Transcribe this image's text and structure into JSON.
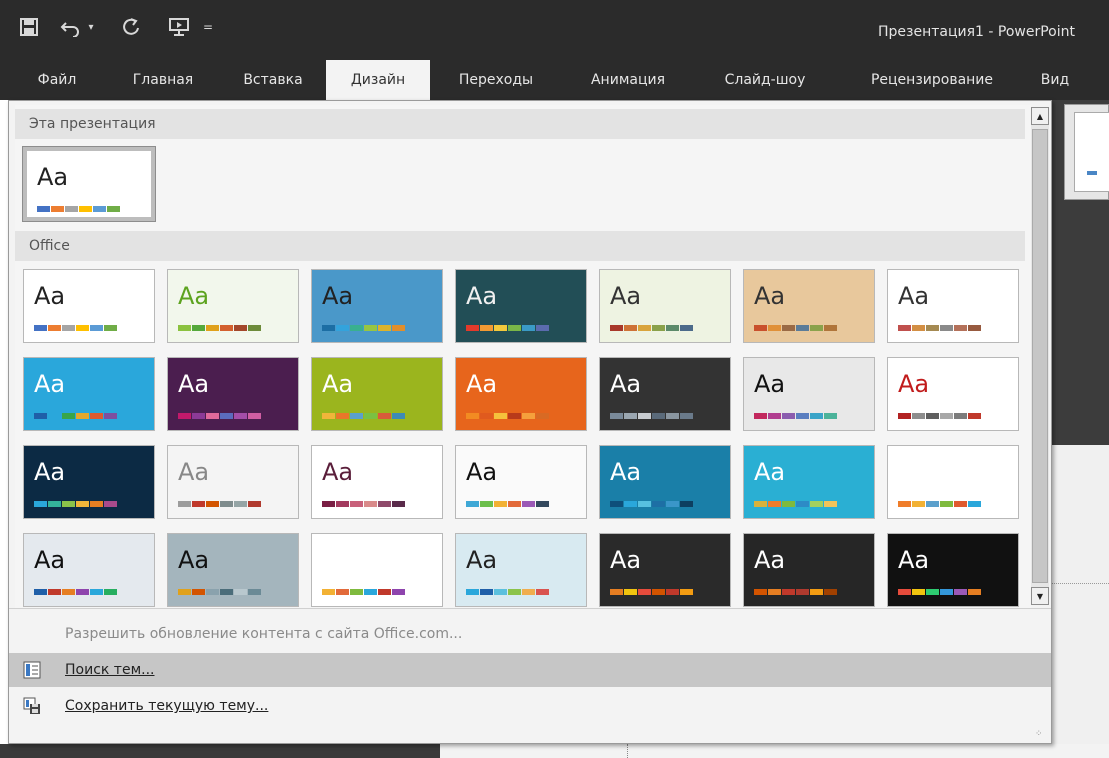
{
  "app": {
    "title": "Презентация1 - PowerPoint",
    "quick_access": [
      "save-icon",
      "undo-icon",
      "redo-icon",
      "start-from-beginning-icon",
      "customize-icon"
    ]
  },
  "tabs": [
    {
      "label": "Файл"
    },
    {
      "label": "Главная"
    },
    {
      "label": "Вставка"
    },
    {
      "label": "Дизайн",
      "active": true
    },
    {
      "label": "Переходы"
    },
    {
      "label": "Анимация"
    },
    {
      "label": "Слайд-шоу"
    },
    {
      "label": "Рецензирование"
    },
    {
      "label": "Вид"
    }
  ],
  "popup": {
    "section_this": "Эта презентация",
    "section_office": "Office",
    "sample_text": "Aa",
    "commands": {
      "enable_updates": "Разрешить обновление контента с сайта Office.com...",
      "browse_themes": "Поиск тем...",
      "save_theme": "Сохранить текущую тему..."
    }
  },
  "themes": [
    {
      "bg": "#ffffff",
      "text": "#222222",
      "bars": [
        "#4472c4",
        "#ed7d31",
        "#a5a5a5",
        "#ffc000",
        "#5b9bd5",
        "#70ad47"
      ]
    },
    {
      "bg": "#ffffff",
      "text": "#222222",
      "bars": [
        "#4472c4",
        "#ed7d31",
        "#a5a5a5",
        "#ffc000",
        "#5b9bd5",
        "#70ad47"
      ]
    },
    {
      "bg": "#f2f7ec",
      "text": "#5da31f",
      "bars": [
        "#8bc23f",
        "#55a93b",
        "#e0a11b",
        "#d3602e",
        "#a3472a",
        "#6d8b3a"
      ]
    },
    {
      "bg": "#4a98c9",
      "text": "#222222",
      "bars": [
        "#1c6ea4",
        "#33a3dc",
        "#39b08f",
        "#98c541",
        "#ddb32a",
        "#e08e2c"
      ]
    },
    {
      "bg": "#224e56",
      "text": "#f0f0f0",
      "bars": [
        "#e33a2b",
        "#f29a33",
        "#f3c93c",
        "#7ab648",
        "#3a9ac6",
        "#5b6bae"
      ]
    },
    {
      "bg": "#eef3e2",
      "text": "#333333",
      "bars": [
        "#a8382a",
        "#ce7236",
        "#d9a43c",
        "#8aa14a",
        "#5c8a6a",
        "#4c6a8a"
      ]
    },
    {
      "bg": "#e8c89c",
      "text": "#333333",
      "bars": [
        "#c9502c",
        "#e09038",
        "#9a6a45",
        "#5b7c99",
        "#8aa24b",
        "#b0753a"
      ]
    },
    {
      "bg": "#ffffff",
      "text": "#333333",
      "bars": [
        "#c0504d",
        "#d38f44",
        "#a58a52",
        "#8a8a8a",
        "#b4715a",
        "#975a3f"
      ]
    },
    {
      "bg": "#2aa7db",
      "text": "#ffffff",
      "bars": [
        "#1f5fa8",
        "#2aa7db",
        "#38a548",
        "#e4a82d",
        "#dd5a30",
        "#7e4f9f"
      ]
    },
    {
      "bg": "#4b1e4f",
      "text": "#ffffff",
      "bars": [
        "#c2196b",
        "#8b3a96",
        "#e06a9b",
        "#5b6cbd",
        "#a44ea8",
        "#d05ea3"
      ]
    },
    {
      "bg": "#9bb51e",
      "text": "#ffffff",
      "bars": [
        "#f0b53a",
        "#e9772a",
        "#5ba0cc",
        "#7ac142",
        "#d85c3a",
        "#3d8bb5"
      ]
    },
    {
      "bg": "#e7651c",
      "text": "#ffffff",
      "bars": [
        "#f28b22",
        "#e05a1e",
        "#f5c13c",
        "#b83a1a",
        "#f5a03c",
        "#d86a24"
      ]
    },
    {
      "bg": "#333333",
      "text": "#ffffff",
      "bars": [
        "#7a8a9a",
        "#9aa6b0",
        "#c8ccd0",
        "#5a6a7a",
        "#8a96a0",
        "#6a7a8a"
      ]
    },
    {
      "bg": "#e8e8e8",
      "text": "#111111",
      "bars": [
        "#c2285d",
        "#b13d8f",
        "#8b5cae",
        "#5a7ec0",
        "#3aa4c8",
        "#4bb39a"
      ]
    },
    {
      "bg": "#ffffff",
      "text": "#c11c1c",
      "bars": [
        "#b22222",
        "#8e8e8e",
        "#5f5f5f",
        "#a8a8a8",
        "#7c7c7c",
        "#c0392b"
      ]
    },
    {
      "bg": "#0c2a44",
      "text": "#ffffff",
      "bars": [
        "#2aa7db",
        "#34b39a",
        "#8bc34a",
        "#f0b53a",
        "#e67e22",
        "#a94a8b"
      ]
    },
    {
      "bg": "#f4f4f4",
      "text": "#888888",
      "bars": [
        "#9c9c9c",
        "#c0392b",
        "#d35400",
        "#7f8c8d",
        "#95a5a6",
        "#b03a2e"
      ]
    },
    {
      "bg": "#ffffff",
      "text": "#5a1e3a",
      "bars": [
        "#7a1e44",
        "#a33a5e",
        "#c8607a",
        "#d98a8a",
        "#8f4a6a",
        "#5a2a4a"
      ]
    },
    {
      "bg": "#fafafa",
      "text": "#111111",
      "bars": [
        "#3fa8d6",
        "#6cbf4c",
        "#f2b134",
        "#e26a3a",
        "#9b59b6",
        "#34495e"
      ]
    },
    {
      "bg": "#1a7fa8",
      "text": "#ffffff",
      "bars": [
        "#0e4f7a",
        "#2aa7db",
        "#58c1e0",
        "#1d6fa5",
        "#3a96c9",
        "#0d3f60"
      ]
    },
    {
      "bg": "#2aafd3",
      "text": "#ffffff",
      "bars": [
        "#d8b23b",
        "#ef7d2a",
        "#7fba3e",
        "#2d8bc6",
        "#a3d05e",
        "#f2c45a"
      ]
    },
    {
      "bg": "#ffffff",
      "text": "#ffffff",
      "bars": [
        "#ef7d2a",
        "#f2b134",
        "#5ba0cc",
        "#7fba3e",
        "#e05a2e",
        "#2aa7db"
      ]
    },
    {
      "bg": "#e4e9ee",
      "text": "#111111",
      "bars": [
        "#1f5fa8",
        "#c0392b",
        "#e67e22",
        "#8e44ad",
        "#2aa7db",
        "#27ae60"
      ]
    },
    {
      "bg": "#a4b5bd",
      "text": "#111111",
      "bars": [
        "#e0a11b",
        "#d35400",
        "#8aa2ad",
        "#4b6d7a",
        "#b9c8ce",
        "#6b8a96"
      ]
    },
    {
      "bg": "#ffffff",
      "text": "#ffffff",
      "bars": [
        "#f2b134",
        "#e26a3a",
        "#7fba3e",
        "#2aa7db",
        "#c0392b",
        "#8e44ad"
      ]
    },
    {
      "bg": "#d8eaf1",
      "text": "#222222",
      "bars": [
        "#2aa7db",
        "#1f5fa8",
        "#5bc0de",
        "#8bc34a",
        "#f0ad4e",
        "#d9534f"
      ]
    },
    {
      "bg": "#2a2a2a",
      "text": "#ffffff",
      "bars": [
        "#e67e22",
        "#f1c40f",
        "#e74c3c",
        "#d35400",
        "#c0392b",
        "#f39c12"
      ]
    },
    {
      "bg": "#262626",
      "text": "#ffffff",
      "bars": [
        "#d35400",
        "#e67e22",
        "#c0392b",
        "#b03a2e",
        "#f39c12",
        "#a04000"
      ]
    },
    {
      "bg": "#111111",
      "text": "#ffffff",
      "bars": [
        "#e74c3c",
        "#f1c40f",
        "#2ecc71",
        "#3498db",
        "#9b59b6",
        "#e67e22"
      ]
    }
  ]
}
